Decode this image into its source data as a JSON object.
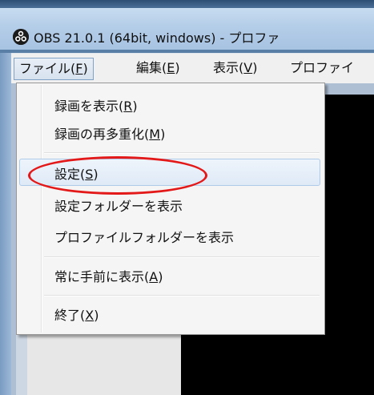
{
  "window": {
    "title": "OBS 21.0.1 (64bit, windows) - プロファ"
  },
  "menubar": {
    "items": [
      {
        "label_main": "ファイル(",
        "accel": "F",
        "label_end": ")"
      },
      {
        "label_main": "編集(",
        "accel": "E",
        "label_end": ")"
      },
      {
        "label_main": "表示(",
        "accel": "V",
        "label_end": ")"
      },
      {
        "label_main": "プロファイ",
        "accel": "",
        "label_end": ""
      }
    ]
  },
  "file_menu": {
    "items": [
      {
        "label_main": "録画を表示(",
        "accel": "R",
        "label_end": ")"
      },
      {
        "label_main": "録画の再多重化(",
        "accel": "M",
        "label_end": ")"
      },
      {
        "label_main": "設定(",
        "accel": "S",
        "label_end": ")"
      },
      {
        "label_main": "設定フォルダーを表示",
        "accel": "",
        "label_end": ""
      },
      {
        "label_main": "プロファイルフォルダーを表示",
        "accel": "",
        "label_end": ""
      },
      {
        "label_main": "常に手前に表示(",
        "accel": "A",
        "label_end": ")"
      },
      {
        "label_main": "終了(",
        "accel": "X",
        "label_end": ")"
      }
    ],
    "hovered_item": "設定(S)",
    "annotation_color": "#e31818"
  },
  "colors": {
    "menu_bg": "#f5f5f5",
    "titlebar": "#b4cde8",
    "preview": "#000000"
  }
}
